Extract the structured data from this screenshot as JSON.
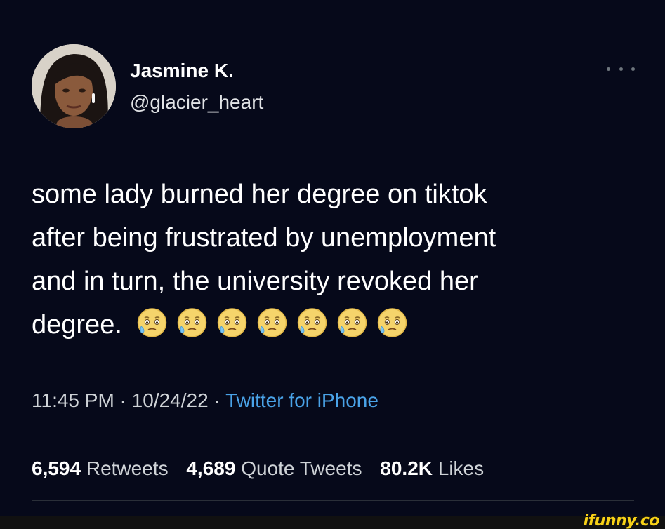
{
  "user": {
    "display_name": "Jasmine K.",
    "handle": "@glacier_heart"
  },
  "tweet": {
    "lines": [
      "some lady burned her degree on tiktok",
      "after being frustrated by unemployment",
      "and in turn, the university revoked her",
      "degree."
    ],
    "emoji_name": "face-holding-back-tears-icon",
    "emoji_count": 7
  },
  "meta": {
    "time": "11:45 PM",
    "separator": " · ",
    "date": "10/24/22",
    "source": "Twitter for iPhone"
  },
  "stats": {
    "retweets_count": "6,594",
    "retweets_label": "Retweets",
    "quotes_count": "4,689",
    "quotes_label": "Quote Tweets",
    "likes_count": "80.2K",
    "likes_label": "Likes"
  },
  "watermark": "ifunny.co",
  "colors": {
    "background": "#06091a",
    "link": "#4aa3e8",
    "watermark": "#f7d117"
  }
}
